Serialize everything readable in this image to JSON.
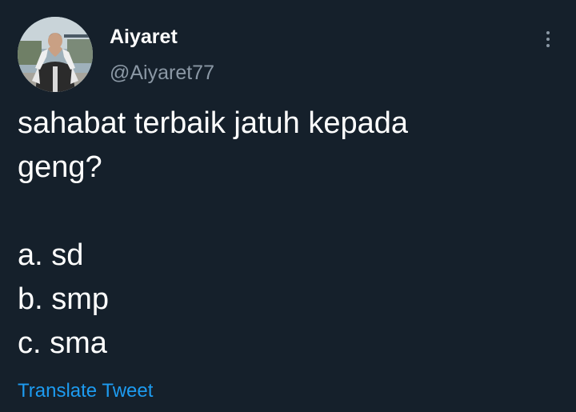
{
  "tweet": {
    "author": {
      "display_name": "Aiyaret",
      "handle": "@Aiyaret77"
    },
    "text_lines": [
      "sahabat terbaik jatuh kepada",
      "geng?",
      "",
      "a. sd",
      "b. smp",
      "c. sma"
    ],
    "translate_label": "Translate Tweet",
    "more_icon": "more-vertical-icon"
  },
  "colors": {
    "background": "#15202b",
    "primary_text": "#ffffff",
    "secondary_text": "#8b98a5",
    "link": "#1d9bf0"
  }
}
